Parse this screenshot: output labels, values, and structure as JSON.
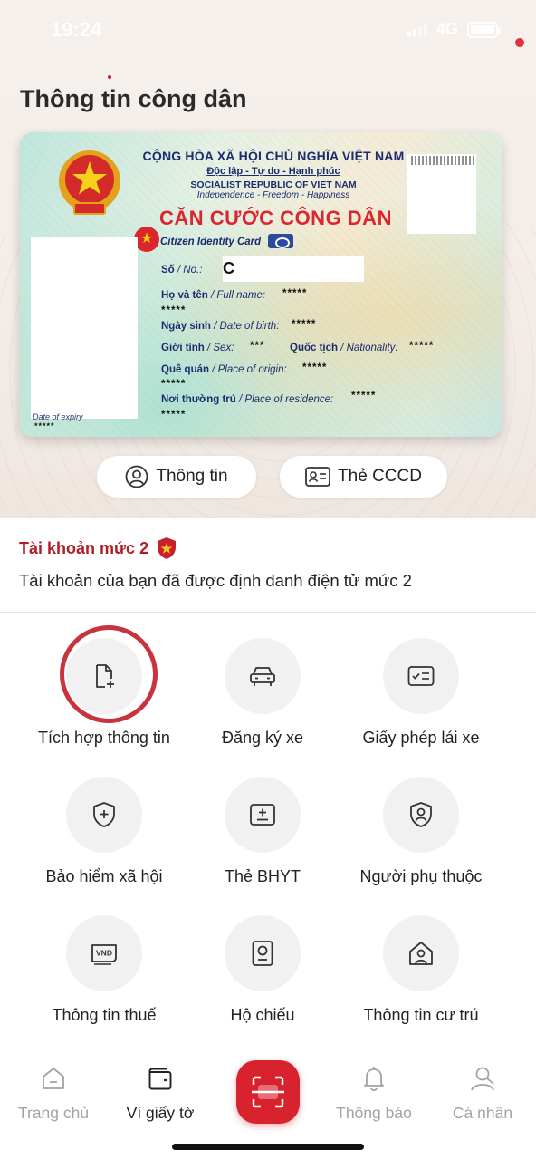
{
  "status_bar": {
    "time": "19:24",
    "network": "4G"
  },
  "page_title": "Thông tin công dân",
  "id_card": {
    "header_line1": "CỘNG HÒA XÃ HỘI CHỦ NGHĨA VIỆT NAM",
    "header_line2": "Độc lập - Tự do - Hạnh phúc",
    "header_line3": "SOCIALIST REPUBLIC OF VIET NAM",
    "header_line4": "Independence - Freedom - Happiness",
    "title": "CĂN CƯỚC CÔNG DÂN",
    "subtitle": "Citizen Identity Card",
    "number_label_vi": "Số",
    "number_label_en": "/ No.:",
    "number_value": "C",
    "name_label_vi": "Họ và tên",
    "name_label_en": "/ Full name:",
    "name_value": "*****",
    "name_value_2": "*****",
    "dob_label_vi": "Ngày sinh",
    "dob_label_en": "/ Date of birth:",
    "dob_value": "*****",
    "sex_label_vi": "Giới tính",
    "sex_label_en": "/ Sex:",
    "sex_value": "***",
    "nationality_label_vi": "Quốc tịch",
    "nationality_label_en": "/ Nationality:",
    "nationality_value": "*****",
    "origin_label_vi": "Quê quán",
    "origin_label_en": "/ Place of origin:",
    "origin_value": "*****",
    "origin_value_2": "*****",
    "residence_label_vi": "Nơi thường trú",
    "residence_label_en": "/ Place of residence:",
    "residence_value": "*****",
    "residence_value_2": "*****",
    "expiry_label": "Date of expiry",
    "expiry_value": "*****"
  },
  "pills": {
    "info": "Thông tin",
    "card": "Thẻ CCCD"
  },
  "account": {
    "level_title": "Tài khoản mức 2",
    "level_desc": "Tài khoản của bạn đã được định danh điện tử mức 2"
  },
  "services": [
    {
      "label": "Tích hợp thông tin",
      "icon": "file-plus-icon"
    },
    {
      "label": "Đăng ký xe",
      "icon": "car-icon"
    },
    {
      "label": "Giấy phép lái xe",
      "icon": "license-card-icon"
    },
    {
      "label": "Bảo hiểm xã hội",
      "icon": "shield-plus-icon"
    },
    {
      "label": "Thẻ BHYT",
      "icon": "health-card-icon"
    },
    {
      "label": "Người phụ thuộc",
      "icon": "shield-person-icon"
    },
    {
      "label": "Thông tin thuế",
      "icon": "vnd-tax-icon"
    },
    {
      "label": "Hộ chiếu",
      "icon": "passport-icon"
    },
    {
      "label": "Thông tin cư trú",
      "icon": "house-person-icon"
    }
  ],
  "bottom_nav": {
    "home": "Trang chủ",
    "wallet": "Ví giấy tờ",
    "notifications": "Thông báo",
    "profile": "Cá nhân"
  },
  "colors": {
    "brand_red": "#d8222d",
    "title_red": "#b01f28",
    "card_navy": "#1b2c6e"
  }
}
